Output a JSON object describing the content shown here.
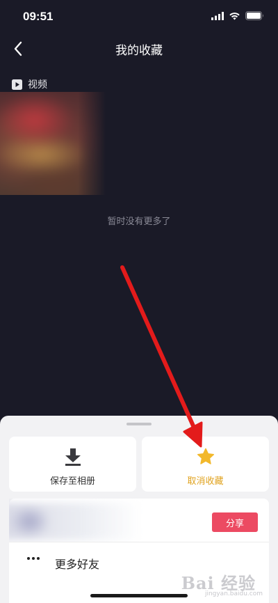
{
  "status_bar": {
    "time": "09:51"
  },
  "header": {
    "title": "我的收藏"
  },
  "section": {
    "label": "视频"
  },
  "empty": {
    "text": "暂时没有更多了"
  },
  "sheet": {
    "actions": [
      {
        "label": "保存至相册",
        "icon": "download-icon"
      },
      {
        "label": "取消收藏",
        "icon": "star-icon"
      }
    ],
    "share_button": "分享",
    "more_friends": "更多好友"
  },
  "colors": {
    "background": "#1a1a27",
    "accent_yellow": "#e0a21d",
    "share_red": "#ec4a62",
    "annotation_arrow": "#e31b1b"
  },
  "watermark": {
    "text": "Bai 经验",
    "sub": "jingyan.baidu.com"
  }
}
